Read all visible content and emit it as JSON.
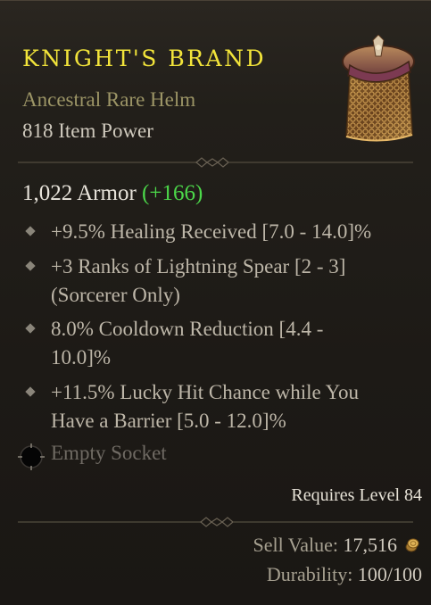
{
  "item": {
    "name": "KNIGHT'S BRAND",
    "type": "Ancestral Rare Helm",
    "item_power": "818 Item Power",
    "art_icon": "helm-icon"
  },
  "armor": {
    "value": "1,022 Armor",
    "bonus": "(+166)"
  },
  "affixes": [
    {
      "line1": "+9.5% Healing Received [7.0 - 14.0]%",
      "line2": ""
    },
    {
      "line1": "+3 Ranks of Lightning Spear [2 - 3]",
      "line2": "(Sorcerer Only)"
    },
    {
      "line1": "8.0% Cooldown Reduction [4.4 -",
      "line2": "10.0]%"
    },
    {
      "line1": "+11.5% Lucky Hit Chance while You",
      "line2": "Have a Barrier [5.0 - 12.0]%"
    }
  ],
  "socket": {
    "label": "Empty Socket",
    "icon": "empty-socket-icon"
  },
  "requirements": "Requires Level 84",
  "sell": {
    "label": "Sell Value:",
    "value": "17,516",
    "icon": "gold-coin-icon"
  },
  "durability": {
    "label": "Durability:",
    "value": "100/100"
  },
  "colors": {
    "title": "#f2e43a",
    "rarity_subtitle": "#9c9566",
    "bonus_green": "#4cd94a",
    "affix_text": "#bdb6a8",
    "socket_text": "#6f6a63"
  }
}
